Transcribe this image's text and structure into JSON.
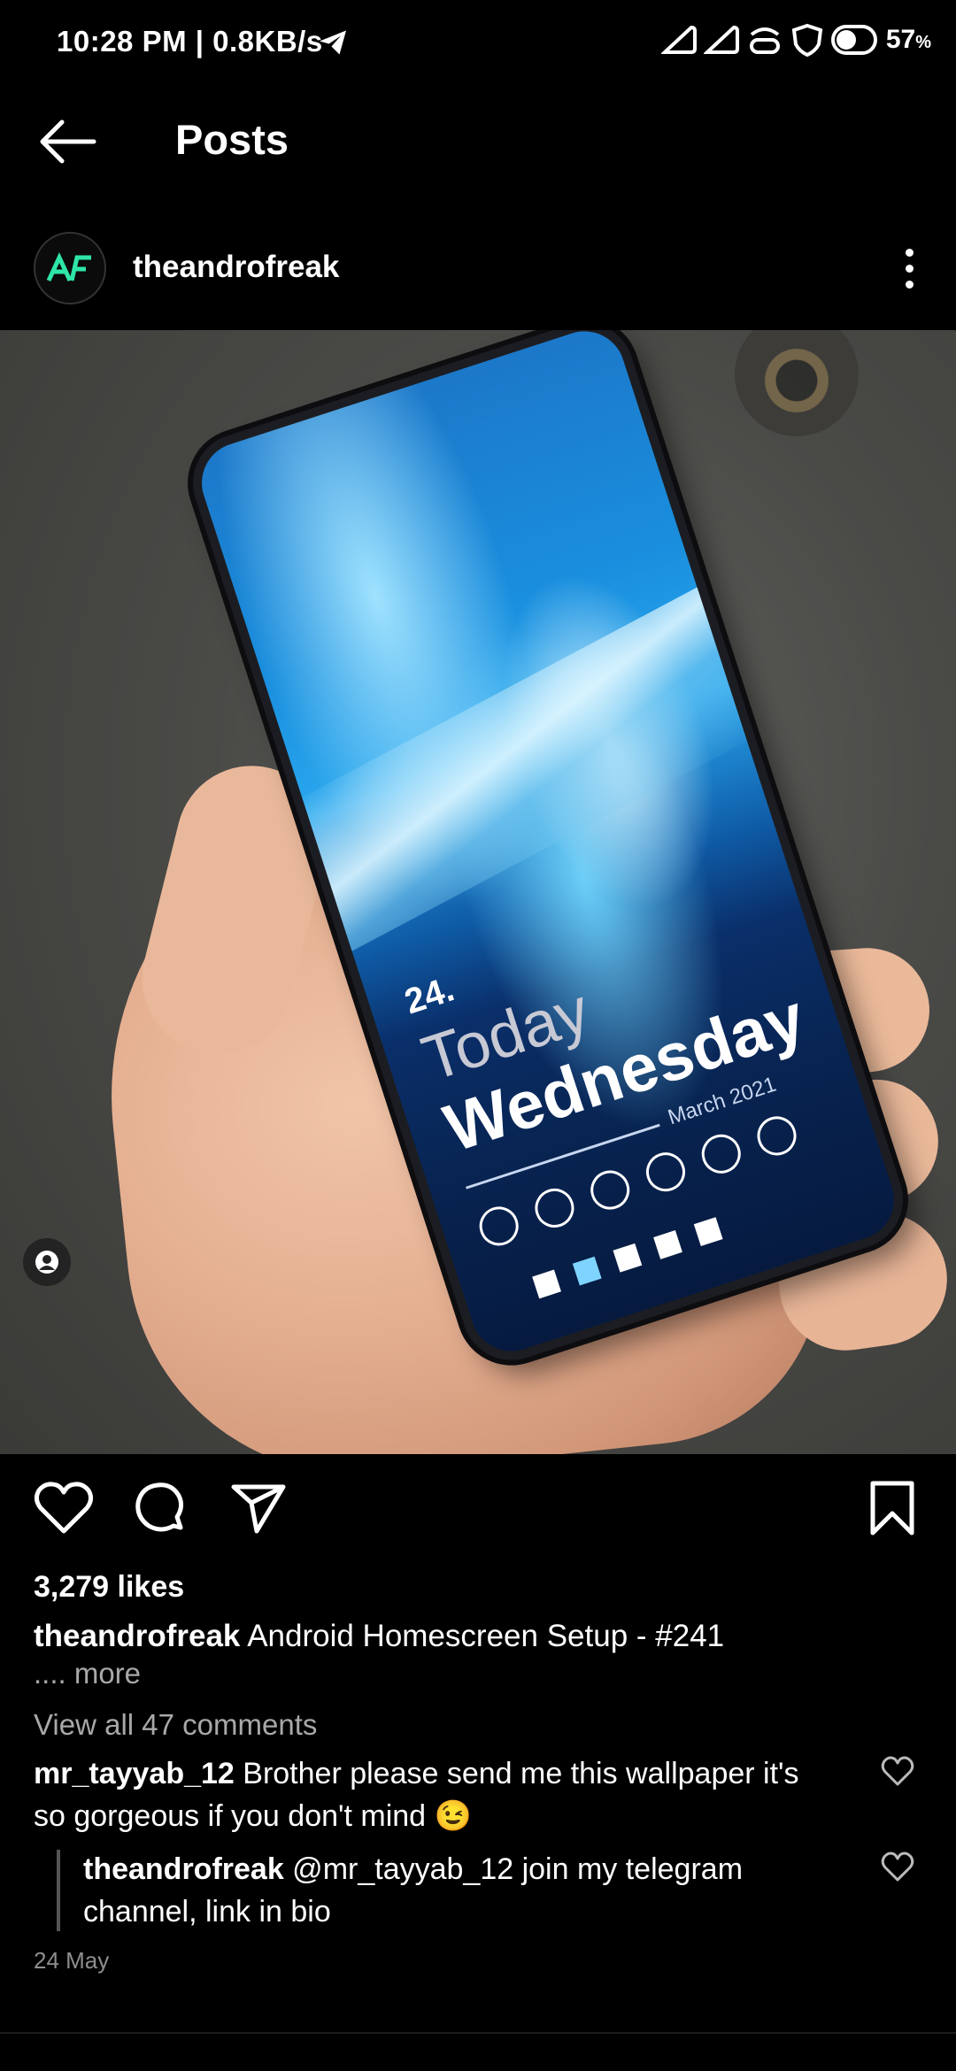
{
  "status_bar": {
    "time": "10:28 PM | 0.8KB/s",
    "battery": "57",
    "battery_unit": "%"
  },
  "header": {
    "title": "Posts"
  },
  "post": {
    "author": "theandrofreak",
    "avatar_text": "AF",
    "screen": {
      "day": "24.",
      "today": "Today",
      "weekday": "Wednesday",
      "month": "March 2021"
    },
    "likes": "3,279 likes",
    "caption_author": "theandrofreak",
    "caption_text": " Android Homescreen Setup - #241",
    "more": ".... more",
    "view_comments": "View all 47 comments"
  },
  "comments": [
    {
      "user": "mr_tayyab_12",
      "text": " Brother please send me this wallpaper it's so gorgeous if you don't mind 😉"
    },
    {
      "user": "theandrofreak",
      "text": " @mr_tayyab_12 join my telegram channel, link in bio"
    }
  ],
  "date": "24 May"
}
